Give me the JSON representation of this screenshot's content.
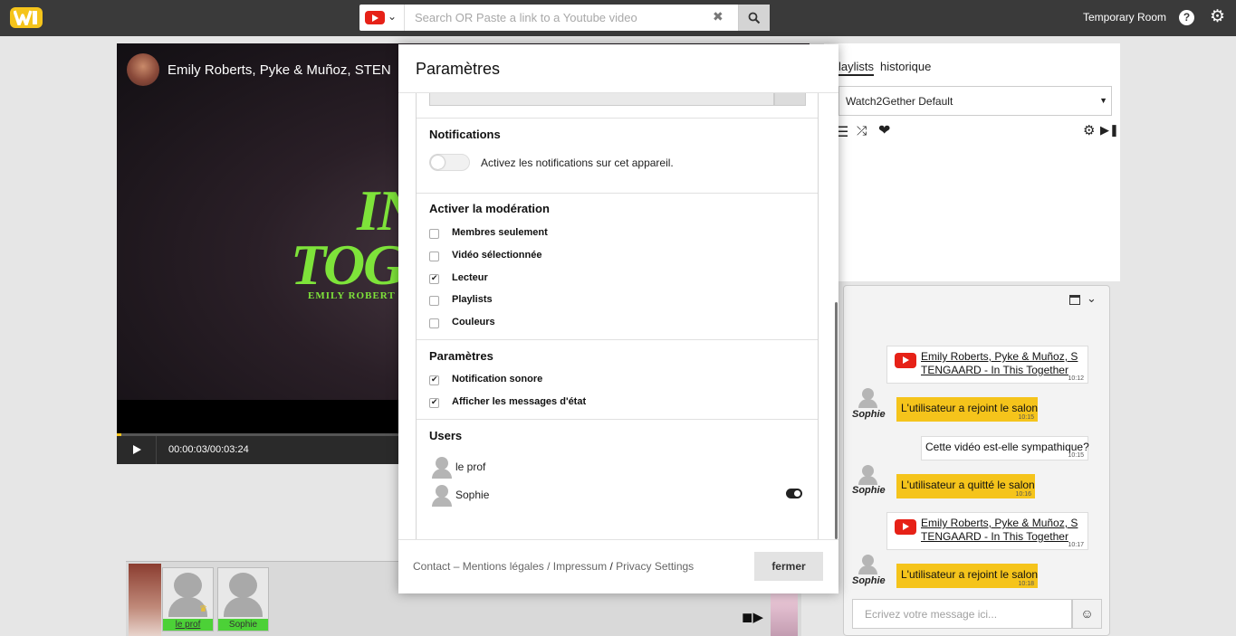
{
  "topbar": {
    "search_placeholder": "Search OR Paste a link to a Youtube video",
    "room_name": "Temporary Room"
  },
  "player": {
    "video_title": "Emily Roberts, Pyke & Muñoz, STEN",
    "cover_line1": "IN",
    "cover_line2": "TOG",
    "cover_line3": "EMILY ROBERT",
    "time": "00:00:03/00:03:24",
    "progress_percent": 1.5
  },
  "users_strip": {
    "users": [
      {
        "name": "le prof"
      },
      {
        "name": "Sophie"
      }
    ]
  },
  "playlist_panel": {
    "tabs": [
      "laylists",
      "historique"
    ],
    "selected_playlist": "Watch2Gether Default"
  },
  "chat": {
    "messages": [
      {
        "kind": "video",
        "text": "Emily Roberts, Pyke & Muñoz, STENGAARD - In This Together",
        "time": "10:12"
      },
      {
        "kind": "status",
        "user": "Sophie",
        "text": "L'utilisateur a rejoint le salon",
        "time": "10:15"
      },
      {
        "kind": "text",
        "text": "Cette vidéo est-elle sympathique?",
        "time": "10:15"
      },
      {
        "kind": "status",
        "user": "Sophie",
        "text": "L'utilisateur a quitté le salon",
        "time": "10:16"
      },
      {
        "kind": "video",
        "text": "Emily Roberts, Pyke & Muñoz, STENGAARD - In This Together",
        "time": "10:17"
      },
      {
        "kind": "status",
        "user": "Sophie",
        "text": "L'utilisateur a rejoint le salon",
        "time": "10:18"
      }
    ],
    "input_placeholder": "Ecrivez votre message ici..."
  },
  "modal": {
    "title": "Paramètres",
    "notifications": {
      "heading": "Notifications",
      "toggle_label": "Activez les notifications sur cet appareil."
    },
    "moderation": {
      "heading": "Activer la modération",
      "options": [
        {
          "label": "Membres seulement",
          "checked": false
        },
        {
          "label": "Vidéo sélectionnée",
          "checked": false
        },
        {
          "label": "Lecteur",
          "checked": true
        },
        {
          "label": "Playlists",
          "checked": false
        },
        {
          "label": "Couleurs",
          "checked": false
        }
      ]
    },
    "settings": {
      "heading": "Paramètres",
      "options": [
        {
          "label": "Notification sonore",
          "checked": true
        },
        {
          "label": "Afficher les messages d'état",
          "checked": true
        }
      ]
    },
    "users": {
      "heading": "Users",
      "list": [
        "le prof",
        "Sophie"
      ]
    },
    "footer": {
      "contact": "Contact – Mentions légales / Impressum",
      "slash": "/",
      "privacy": "Privacy Settings",
      "close_label": "fermer"
    }
  }
}
